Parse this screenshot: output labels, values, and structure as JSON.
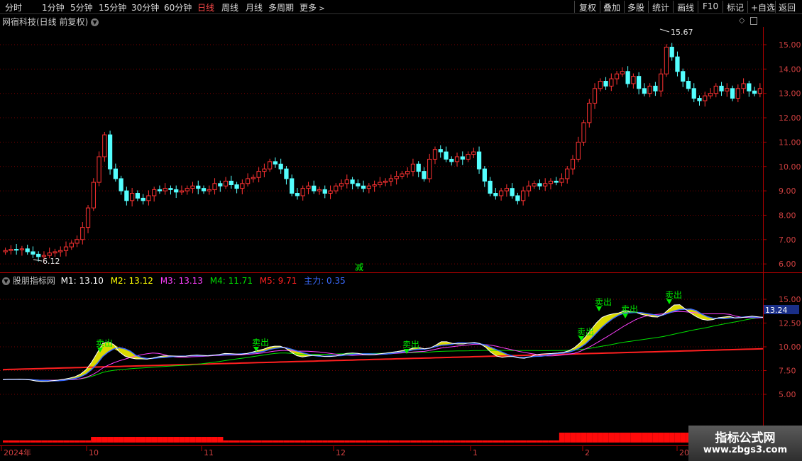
{
  "toolbar": {
    "left_items": [
      "分时",
      "1分钟",
      "5分钟",
      "15分钟",
      "30分钟",
      "60分钟",
      "日线",
      "周线",
      "月线",
      "多周期",
      "更多"
    ],
    "active": "日线",
    "right_items": [
      "复权",
      "叠加",
      "多股",
      "统计",
      "画线",
      "F10",
      "标记",
      "+自选",
      "返回"
    ]
  },
  "main_panel": {
    "title": "网宿科技(日线 前复权)",
    "price_axis": [
      "15.00",
      "14.00",
      "13.00",
      "12.00",
      "11.00",
      "10.00",
      "9.00",
      "8.00",
      "7.00",
      "6.00"
    ],
    "high_label": "15.67",
    "low_label": "6.12",
    "marker_text": "减"
  },
  "indicator_panel": {
    "name": "股朋指标网",
    "m1": "M1: 13.10",
    "m2": "M2: 13.12",
    "m3": "M3: 13.13",
    "m4": "M4: 11.71",
    "m5": "M5: 9.71",
    "zhuli": "主力: 0.35",
    "axis": [
      "15.00",
      "12.50",
      "10.00",
      "7.50",
      "5.00"
    ],
    "current_value": "13.24",
    "sell_label": "卖出"
  },
  "time_axis": {
    "labels": [
      "2024年",
      "10",
      "11",
      "12",
      "1",
      "2",
      "20"
    ]
  },
  "watermark": {
    "line1": "指标公式网",
    "line2": "www.zbgs3.com"
  },
  "colors": {
    "up": "#ff3232",
    "down": "#54ffff",
    "grid": "#7a0000",
    "m1": "#ffffff",
    "m2": "#ffff00",
    "m3": "#ff40ff",
    "m4": "#00e000",
    "m5": "#ff2020",
    "zhuli": "#3a6bff",
    "sell": "#00ee00"
  }
}
